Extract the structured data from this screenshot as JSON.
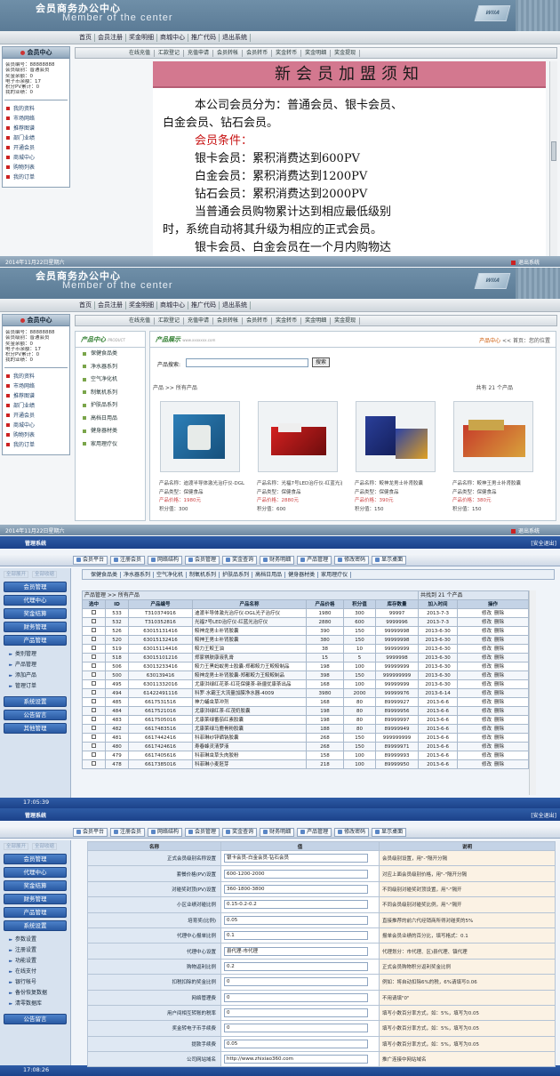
{
  "site": {
    "title_cn": "会员商务办公中心",
    "title_en": "Member of the center",
    "logo": "WIIA",
    "nav": [
      "首页",
      "会员注册",
      "奖金明细",
      "商城中心",
      "推广代码",
      "退出系统"
    ],
    "subnav": [
      "在线充值",
      "汇款登记",
      "充值申请",
      "会员转帐",
      "会员转币",
      "奖金转币",
      "奖金明细",
      "奖金提现"
    ]
  },
  "member_panel": {
    "title": "会员中心",
    "info": [
      "会员编号：88888888",
      "会员级别：普通会员",
      "奖金余额：0",
      "电子币余额：17",
      "积分PV累计：0",
      "我的业绩：0"
    ],
    "links": [
      "我的资料",
      "市场网络",
      "推荐图谱",
      "部门业绩",
      "开通会员",
      "商城中心",
      "购物列表",
      "我的订单"
    ]
  },
  "notice": {
    "title": "新会员加盟须知",
    "lines": [
      "本公司会员分为：普通会员、银卡会员、",
      "白金会员、钻石会员。",
      "会员条件：",
      "银卡会员：累积消费达到600PV",
      "白金会员：累积消费达到1200PV",
      "钻石会员：累积消费达到2000PV",
      "当普通会员购物累计达到相应最低级别",
      "时，系统自动将其升级为相应的正式会员。",
      "银卡会员、白金会员在一个月内购物达"
    ]
  },
  "status_bar": {
    "date": "2014年11月22日星期六",
    "logout": "退出系统"
  },
  "products": {
    "left_title": "产品中心",
    "left_title_en": "PRODUCT",
    "categories": [
      "保健食品类",
      "净水器系列",
      "空气净化机",
      "制氧机系列",
      "护肤品系列",
      "高档日用品",
      "健身器材类",
      "家用理疗仪"
    ],
    "main_title": "产品展示",
    "main_title_en": "www.xxxxxxx.com",
    "breadcrumb_home": "产品中心",
    "breadcrumb_rest": "<< 首页：您的位置",
    "search_label": "产品搜索:",
    "search_button": "搜索",
    "crumb": "产品 >> 所有产品",
    "count": "共有 21 个产品",
    "cards": [
      {
        "name": "产品名称：迪渡半导体激光治疗仪-DGL光子治疗仪",
        "type": "产品类型：保健食品",
        "price": "产品价格：1980元",
        "pv": "积分值：300"
      },
      {
        "name": "产品名称：光福7号LED治疗仪-红蓝光治疗仪",
        "type": "产品类型：保健食品",
        "price": "产品价格：2880元",
        "pv": "积分值：600"
      },
      {
        "name": "产品名称：鲛神龙男士补肾胶囊",
        "type": "产品类型：保健食品",
        "price": "产品价格：390元",
        "pv": "积分值：150"
      },
      {
        "name": "产品名称：鲛神王男士补肾胶囊",
        "type": "产品类型：保健食品",
        "price": "产品价格：380元",
        "pv": "积分值：150"
      }
    ]
  },
  "admin": {
    "title": "管理系统",
    "logout": "[安全退出]",
    "toolbar": [
      "会员平台",
      "注册会员",
      "网络结构",
      "会员管理",
      "奖金查询",
      "财务明细",
      "产品管理",
      "修改密码",
      "显示桌面"
    ],
    "side_tabs": [
      "全部展开",
      "全部收缩"
    ],
    "menus": [
      "会员管理",
      "代理中心",
      "奖金结算",
      "财务管理",
      "产品管理"
    ],
    "product_sub": [
      "类别管理",
      "产品管理",
      "添加产品",
      "管理订单"
    ],
    "menus_after": [
      "系统设置",
      "公告留言",
      "其他管理"
    ],
    "time1": "17:05:39",
    "time2": "17:08:26"
  },
  "product_admin": {
    "categories": [
      "保健食品类",
      "净水器系列",
      "空气净化机",
      "制氧机系列",
      "护肤品系列",
      "高档日用品",
      "健身器材类",
      "家用理疗仪"
    ],
    "caption": "产品管理 >> 所有产品",
    "caption_count": "共找到 21 个产品",
    "headers": [
      "选中",
      "ID",
      "产品编号",
      "产品名称",
      "产品价格",
      "积分值",
      "库存数量",
      "加入时间",
      "操作"
    ],
    "rows": [
      [
        "533",
        "T310374916",
        "迪渡半导体激光治疗仪-DGL光子治疗仪",
        "1980",
        "300",
        "99997",
        "2013-7-3"
      ],
      [
        "532",
        "T310352816",
        "光福7号LED治疗仪-红蓝光治疗仪",
        "2880",
        "600",
        "9999996",
        "2013-7-3"
      ],
      [
        "526",
        "63015131416",
        "鲛神龙男士补肾胶囊",
        "390",
        "150",
        "99999998",
        "2013-6-30"
      ],
      [
        "520",
        "63015132416",
        "鲛神王男士补肾胶囊",
        "380",
        "150",
        "99999998",
        "2013-6-30"
      ],
      [
        "519",
        "63015114416",
        "鲛力王鲛王油",
        "38",
        "10",
        "99999999",
        "2013-6-30"
      ],
      [
        "518",
        "63015101216",
        "郑家祺肤康液乳膏",
        "15",
        "5",
        "9999998",
        "2013-6-30"
      ],
      [
        "506",
        "63013233416",
        "鲛力王黑蚂蚁男士胶囊-郑都鲛力王鲛鲛制品",
        "198",
        "100",
        "99999999",
        "2013-6-30"
      ],
      [
        "500",
        "63013941​6",
        "鲛神龙男士补肾胶囊-郑都鲛力王鲛鲛制品",
        "398",
        "150",
        "999999999",
        "2013-6-30"
      ],
      [
        "495",
        "63011332016",
        "尤康洪绿红花茶-红花保健茶-新疆优康茶出品",
        "168",
        "100",
        "99999999",
        "2013-6-30"
      ],
      [
        "494",
        "61422491116",
        "科罗·水霸王大流量加膜净水器-4009",
        "3980",
        "2000",
        "99999976",
        "2013-6-14"
      ],
      [
        "485",
        "6617531516",
        "神力蛹虫草冲剂",
        "168",
        "80",
        "89999927",
        "2013-6-6"
      ],
      [
        "484",
        "6617521016",
        "尤康洪绿红茶-红茂奶胶囊",
        "198",
        "80",
        "89999956",
        "2013-6-6"
      ],
      [
        "483",
        "6617505016",
        "尤康莱绿番茄红素胶囊",
        "198",
        "80",
        "89999997",
        "2013-6-6"
      ],
      [
        "482",
        "6617483516",
        "尤康莱绿马鹿骨粉胶囊",
        "188",
        "80",
        "89999949",
        "2013-6-6"
      ],
      [
        "481",
        "6617442416",
        "科菲琳纱锌硒钠胶囊",
        "268",
        "150",
        "999999999",
        "2013-6-6"
      ],
      [
        "480",
        "6617424616",
        "寿春蜂灵清梦液",
        "268",
        "150",
        "89999971",
        "2013-6-6"
      ],
      [
        "479",
        "6617405616",
        "科菲琳虫草头肉胶粉",
        "158",
        "100",
        "89999993",
        "2013-6-6"
      ],
      [
        "478",
        "6617385016",
        "科菲琳小麦胚芽",
        "218",
        "100",
        "89999950",
        "2013-6-6"
      ]
    ],
    "op_edit": "修改",
    "op_delete": "删除"
  },
  "settings_admin": {
    "side_sub": [
      "参数设置",
      "注册设置",
      "功能设置",
      "在线支付",
      "银行帐号",
      "备份恢复数据",
      "清零数据库"
    ],
    "last_menu": "公告留言",
    "headers": [
      "名称",
      "值",
      "说明"
    ],
    "rows": [
      {
        "label": "正式会员级别名称设置",
        "value": "银卡会员-白金会员-钻石会员",
        "desc": "会员级别设置，用\"-\"隔开分隔"
      },
      {
        "label": "套餐价格(PV)设置",
        "value": "600-1200-2000",
        "desc": "对应上面会员级别价格，用\"-\"隔开分隔"
      },
      {
        "label": "对碰奖封顶(PV)设置",
        "value": "360-1800-3800",
        "desc": "不同级别对碰奖封顶设置，用\"-\"隔开"
      },
      {
        "label": "小区业绩对碰比例",
        "value": "0.15-0.2-0.2",
        "desc": "不同会员级别对碰奖比例，用\"-\"隔开"
      },
      {
        "label": "培育奖(比例)",
        "value": "0.05",
        "desc": "直接推荐的前六代经销商所得对碰奖的5%"
      },
      {
        "label": "代理中心报单比例",
        "value": "0.1",
        "desc": "报单会员业绩的百分比，填写格式：0.1"
      },
      {
        "label": "代理中心设置",
        "value": "县代理-市代理",
        "desc": "代理划分：市代理、区)县代理、镇代理"
      },
      {
        "label": "购物返利比例",
        "value": "0.2",
        "desc": "正式会员购物积分返利奖金比例"
      },
      {
        "label": "扣税扣除的奖金比例",
        "value": "0",
        "desc": "例如：将自动扣除6%的税，6%请填写0.06"
      },
      {
        "label": "网络管理费",
        "value": "0",
        "desc": "不用请填\"0\""
      },
      {
        "label": "用户间相互转账的税率",
        "value": "0",
        "desc": "填写小数百分率方式，如：5%，填写为0.05"
      },
      {
        "label": "奖金转电子币手续费",
        "value": "0",
        "desc": "填写小数百分率方式，如：5%，填写为0.05"
      },
      {
        "label": "提款手续费",
        "value": "0.05",
        "desc": "填写小数百分率方式，如：5%，填写为0.05"
      },
      {
        "label": "公司网站域名",
        "value": "http://www.zhixiao360.com",
        "desc": "推广连接中网站域名"
      }
    ]
  }
}
